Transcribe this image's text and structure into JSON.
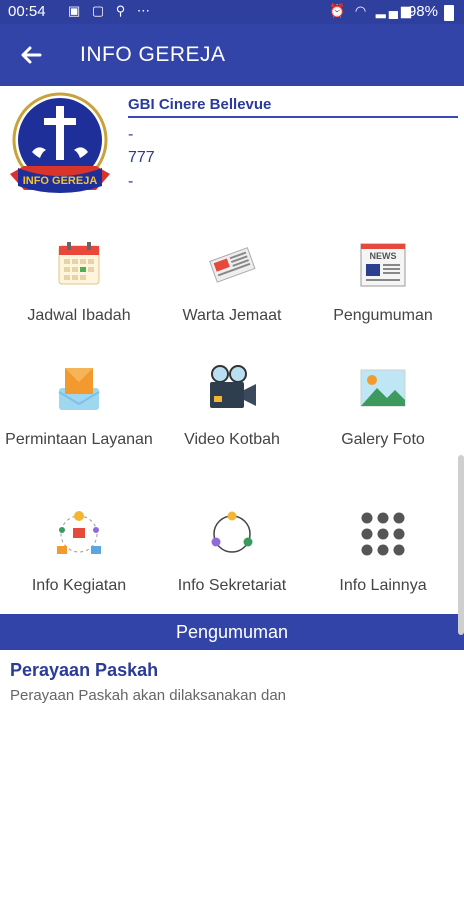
{
  "status_bar": {
    "time": "00:54",
    "battery": "98%"
  },
  "app_bar": {
    "title": "INFO GEREJA"
  },
  "church": {
    "name": "GBI Cinere Bellevue",
    "line1": "-",
    "line2": "777",
    "line3": "-",
    "logo_text": "INFO GEREJA"
  },
  "menu": [
    {
      "label": "Jadwal Ibadah",
      "icon": "calendar-icon"
    },
    {
      "label": "Warta Jemaat",
      "icon": "newspaper-icon"
    },
    {
      "label": "Pengumuman",
      "icon": "news-icon"
    },
    {
      "label": "Permintaan Layanan",
      "icon": "envelope-icon"
    },
    {
      "label": "Video Kotbah",
      "icon": "video-camera-icon"
    },
    {
      "label": "Galery Foto",
      "icon": "photo-icon"
    },
    {
      "label": "Info Kegiatan",
      "icon": "activity-icon"
    },
    {
      "label": "Info Sekretariat",
      "icon": "network-icon"
    },
    {
      "label": "Info Lainnya",
      "icon": "dots-grid-icon"
    }
  ],
  "announcements": {
    "header": "Pengumuman",
    "items": [
      {
        "title": "Perayaan Paskah",
        "text": "Perayaan Paskah akan dilaksanakan dan"
      }
    ]
  },
  "colors": {
    "primary": "#3244a8",
    "status": "#2f3f9e",
    "accent_text": "#2a3b9a"
  }
}
